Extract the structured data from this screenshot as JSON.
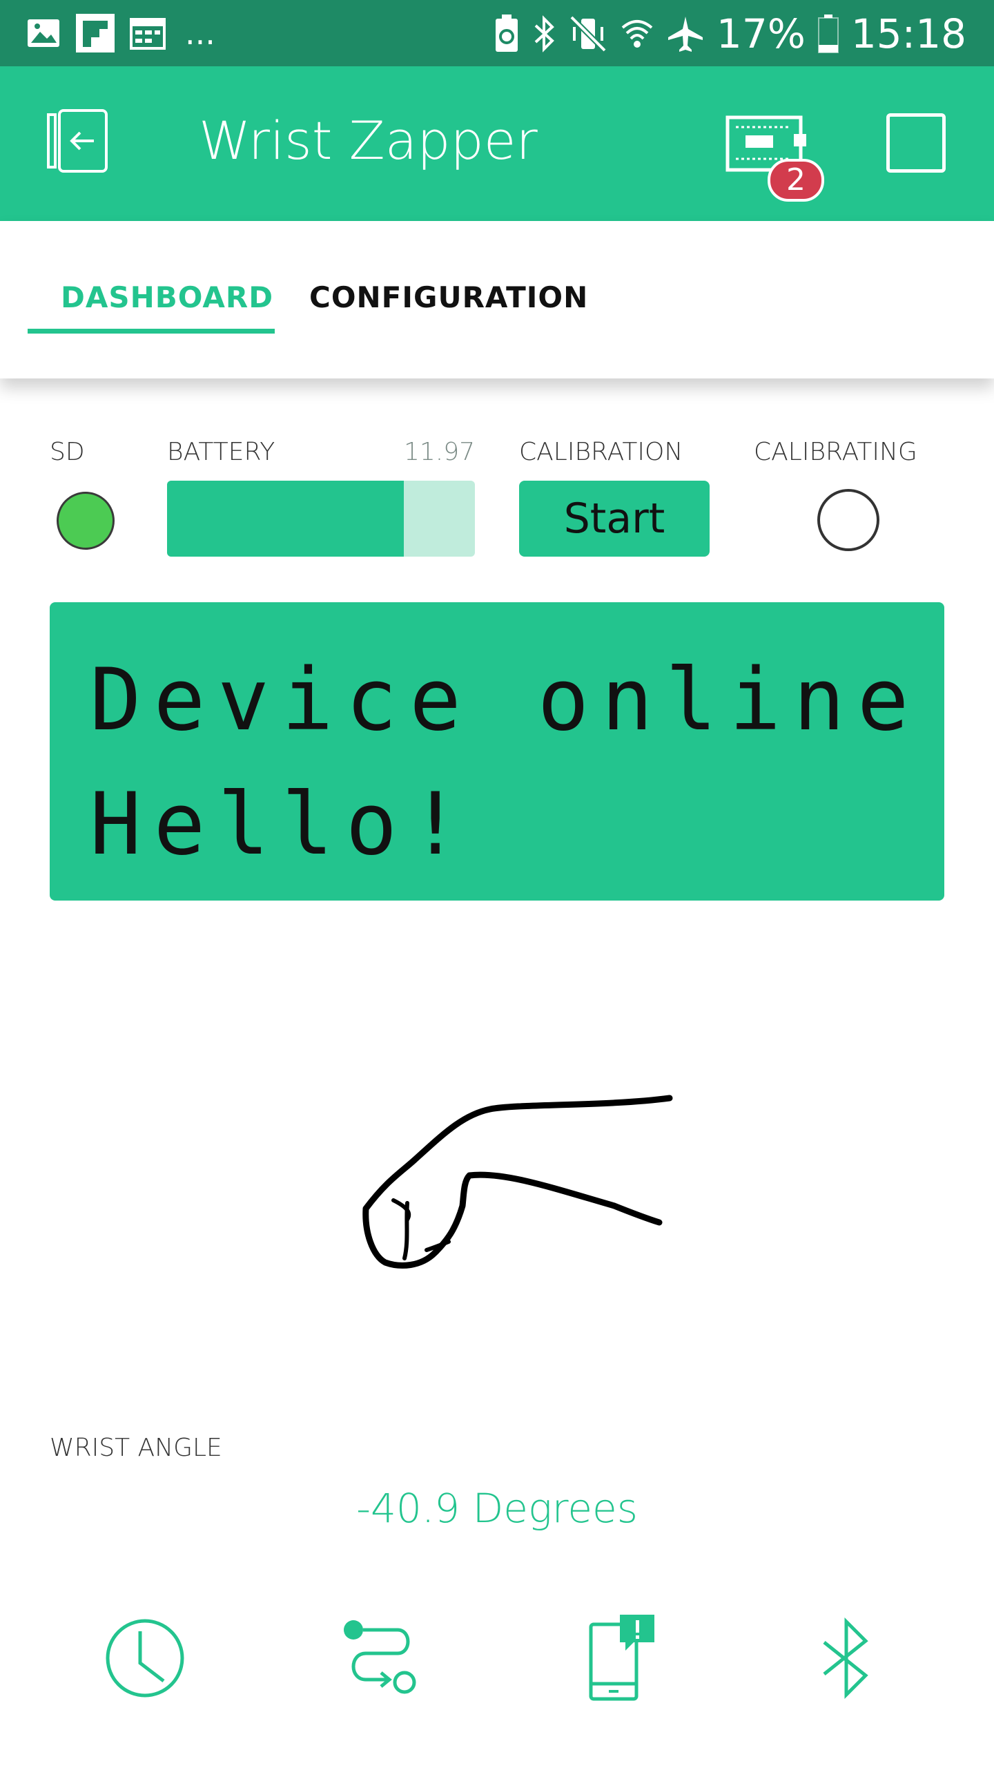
{
  "status_bar": {
    "icons_left": [
      "image-icon",
      "flipboard-icon",
      "calendar-icon"
    ],
    "more": "...",
    "icons_right": [
      "battery-saver-icon",
      "bluetooth-icon",
      "vibrate-off-icon",
      "wifi-icon",
      "airplane-icon"
    ],
    "battery_percent": "17%",
    "time": "15:18"
  },
  "app_bar": {
    "title": "Wrist Zapper",
    "device_badge_count": "2",
    "color": "#23c48e"
  },
  "tabs": [
    {
      "label": "DASHBOARD",
      "active": true
    },
    {
      "label": "CONFIGURATION",
      "active": false
    }
  ],
  "widgets": {
    "sd": {
      "label": "SD",
      "led_color": "#4ccb53",
      "on": true
    },
    "battery": {
      "label": "BATTERY",
      "value": "11.97",
      "level_fraction": 0.77
    },
    "calibration": {
      "label": "CALIBRATION",
      "button_label": "Start"
    },
    "calibrating": {
      "label": "CALIBRATING",
      "on": false
    }
  },
  "lcd": {
    "line1": "Device online",
    "line2": "Hello!"
  },
  "wrist": {
    "label": "WRIST ANGLE",
    "value": "-40.9 Degrees"
  },
  "bottom_nav": [
    "clock-icon",
    "route-icon",
    "phone-alert-icon",
    "bluetooth-icon"
  ]
}
